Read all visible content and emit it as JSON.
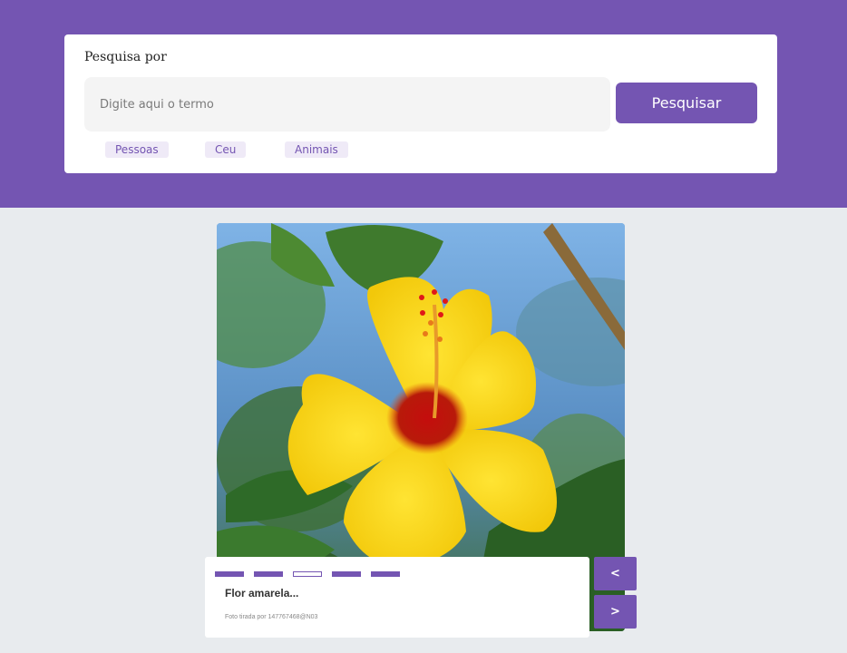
{
  "search": {
    "title": "Pesquisa por",
    "placeholder": "Digite aqui o termo",
    "button_label": "Pesquisar",
    "tags": [
      "Pessoas",
      "Ceu",
      "Animais"
    ]
  },
  "carousel": {
    "slide_count": 5,
    "active_index": 2,
    "caption_title": "Flor amarela...",
    "caption_credit": "Foto tirada por 147767468@N03",
    "prev_label": "<",
    "next_label": ">"
  },
  "colors": {
    "accent": "#7455b2",
    "background": "#e8ebee"
  }
}
